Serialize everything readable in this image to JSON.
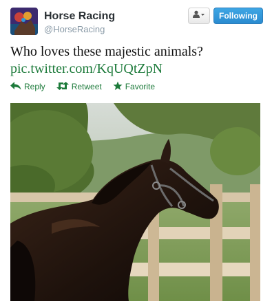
{
  "account": {
    "name": "Horse Racing",
    "handle": "@HorseRacing"
  },
  "header": {
    "follow_label": "Following"
  },
  "tweet": {
    "text": "Who loves these majestic animals?",
    "link": "pic.twitter.com/KqUQtZpN"
  },
  "actions": [
    {
      "label": "Reply",
      "icon": "reply-icon"
    },
    {
      "label": "Retweet",
      "icon": "retweet-icon"
    },
    {
      "label": "Favorite",
      "icon": "star-icon"
    }
  ],
  "colors": {
    "follow_button": "#2a8bd0",
    "link": "#1c7a3a"
  }
}
